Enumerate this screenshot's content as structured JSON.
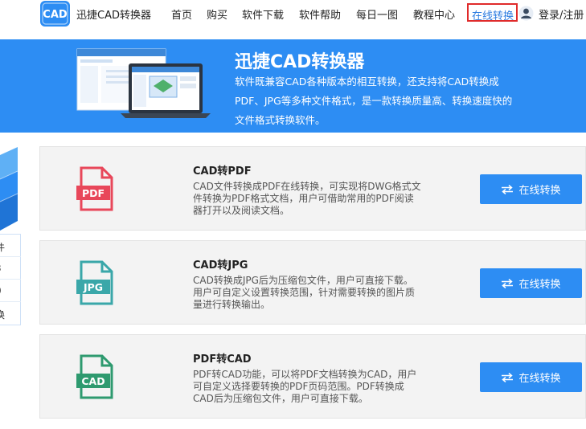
{
  "header": {
    "logo_text": "CAD",
    "brand": "迅捷CAD转换器",
    "nav": [
      "首页",
      "购买",
      "软件下载",
      "软件帮助",
      "每日一图",
      "教程中心"
    ],
    "nav_active": "在线转换",
    "login": "登录/注册"
  },
  "banner": {
    "title": "迅捷CAD转换器",
    "lines": [
      "软件既兼容CAD各种版本的相互转换，还支持将CAD转换成",
      "PDF、JPG等多种文件格式，是一款转换质量高、转换速度快的",
      "文件格式转换软件。"
    ]
  },
  "sidebar": {
    "items": [
      "件",
      "3",
      "0",
      "换"
    ]
  },
  "cards": [
    {
      "title": "CAD转PDF",
      "icon": "pdf-file-icon",
      "icon_label": "PDF",
      "icon_color": "#e8475a",
      "desc": [
        "CAD文件转换成PDF在线转换，可实现将DWG格式文",
        "件转换为PDF格式文档，用户可借助常用的PDF阅读",
        "器打开以及阅读文档。"
      ],
      "button": "在线转换"
    },
    {
      "title": "CAD转JPG",
      "icon": "jpg-file-icon",
      "icon_label": "JPG",
      "icon_color": "#3aa7a9",
      "desc": [
        "CAD转换成JPG后为压缩包文件，用户可直接下载。",
        "用户可自定义设置转换范围，针对需要转换的图片质",
        "量进行转换输出。"
      ],
      "button": "在线转换"
    },
    {
      "title": "PDF转CAD",
      "icon": "cad-file-icon",
      "icon_label": "CAD",
      "icon_color": "#2e9a6f",
      "desc": [
        "PDF转CAD功能，可以将PDF文档转换为CAD，用户",
        "可自定义选择要转换的PDF页码范围。PDF转换成",
        "CAD后为压缩包文件，用户可直接下载。"
      ],
      "button": "在线转换"
    }
  ],
  "colors": {
    "accent": "#2d8df3",
    "active_border": "#e02a2a"
  }
}
